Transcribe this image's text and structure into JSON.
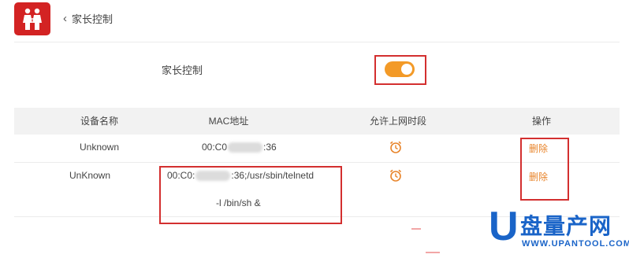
{
  "header": {
    "back_icon": "chevron-left-icon",
    "title": "家长控制"
  },
  "app_icon": {
    "name": "family-icon",
    "color": "#d32323"
  },
  "parental_control": {
    "label": "家长控制",
    "enabled": true,
    "accent": "#f39a27"
  },
  "table": {
    "headers": [
      "设备名称",
      "MAC地址",
      "允许上网时段",
      "操作"
    ],
    "rows": [
      {
        "name": "Unknown",
        "mac_prefix": "00:C0",
        "mac_suffix": ":36",
        "action": "删除",
        "time_icon": "alarm-clock-icon"
      },
      {
        "name": "UnKnown",
        "mac_prefix": "00:C0:",
        "mac_suffix": ":36;/usr/sbin/telnetd",
        "mac_line2": "-l /bin/sh &",
        "action": "删除",
        "time_icon": "alarm-clock-icon"
      }
    ]
  },
  "highlight_color": "#d32f2f",
  "watermark": {
    "letter": "U",
    "text": "盘量产网",
    "url": "WWW.UPANTOOL.COM"
  }
}
